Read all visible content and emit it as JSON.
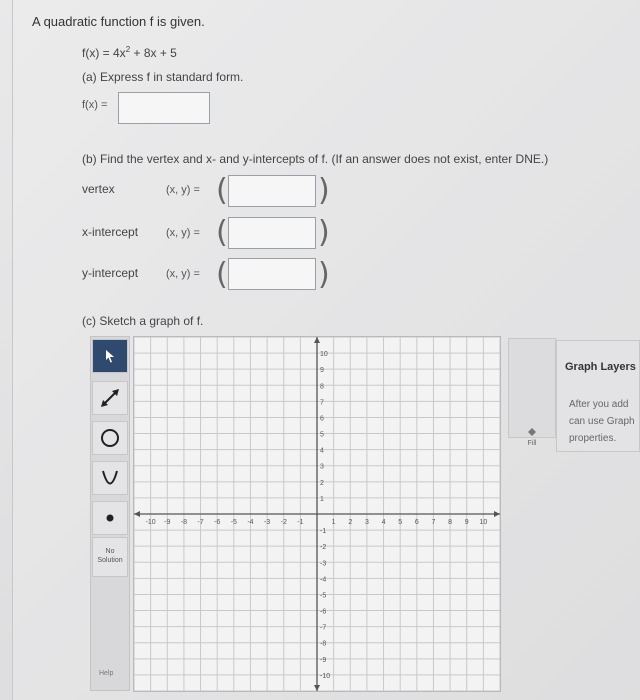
{
  "prompt": "A quadratic function f is given.",
  "function": {
    "lhs": "f(x) = 4x",
    "exp": "2",
    "rhs": " + 8x + 5"
  },
  "part_a": {
    "instruction": "(a) Express f in standard form.",
    "field_label": "f(x) =",
    "value": ""
  },
  "part_b": {
    "instruction": "(b) Find the vertex and x- and y-intercepts of f. (If an answer does not exist, enter DNE.)",
    "rows": [
      {
        "label": "vertex",
        "xy": "(x, y) =",
        "value": ""
      },
      {
        "label": "x-intercept",
        "xy": "(x, y) =",
        "value": ""
      },
      {
        "label": "y-intercept",
        "xy": "(x, y) =",
        "value": ""
      }
    ]
  },
  "part_c": {
    "instruction": "(c) Sketch a graph of f."
  },
  "toolbar": {
    "tools": [
      "arrow-icon",
      "line-icon",
      "circle-icon",
      "parabola-icon",
      "point-icon"
    ],
    "no_solution": "No Solution",
    "help": "Help"
  },
  "graph": {
    "x_range": [
      -11,
      11
    ],
    "y_range": [
      -11,
      11
    ],
    "x_ticks": [
      "-10",
      "-9",
      "-8",
      "-7",
      "-6",
      "-5",
      "-4",
      "-3",
      "-2",
      "-1",
      "1",
      "2",
      "3",
      "4",
      "5",
      "6",
      "7",
      "8",
      "9",
      "10"
    ],
    "y_ticks": [
      "10",
      "9",
      "8",
      "7",
      "6",
      "5",
      "4",
      "3",
      "2",
      "1",
      "-1",
      "-2",
      "-3",
      "-4",
      "-5",
      "-6",
      "-7",
      "-8",
      "-9",
      "-10"
    ]
  },
  "fill_label": "Fill",
  "graph_layers": {
    "title": "Graph Layers",
    "text_lines": [
      "After you add",
      "can use Graph",
      "properties."
    ]
  },
  "colors": {
    "active_tool": "#2f4a6e",
    "grid_line": "#c9c9c9",
    "axis": "#555555"
  }
}
